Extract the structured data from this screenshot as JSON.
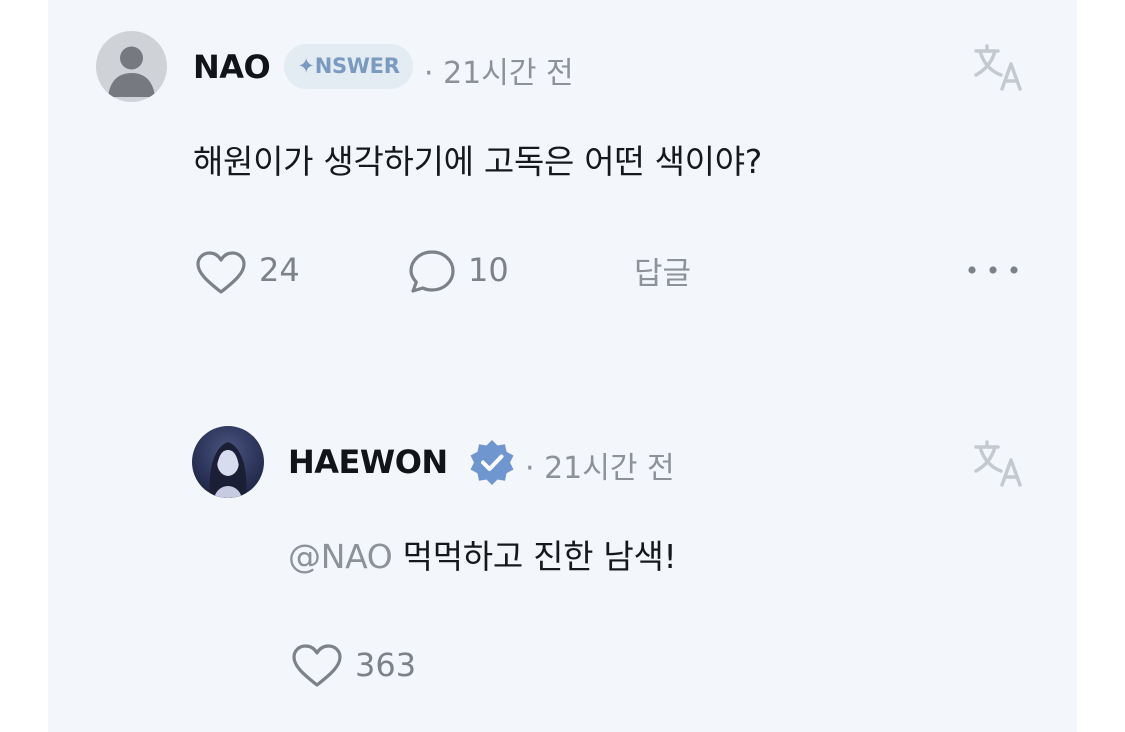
{
  "comment": {
    "username": "NAO",
    "badge": "✦NSWER",
    "time": "· 21시간 전",
    "text": "해원이가 생각하기에 고독은 어떤 색이야?",
    "likes": "24",
    "replies": "10",
    "reply_label": "답글",
    "more_icon": "more-horizontal-icon",
    "translate_icon": "translate-icon"
  },
  "reply": {
    "username": "HAEWON",
    "verified_icon": "verified-badge-icon",
    "time": "· 21시간 전",
    "mention": "@NAO",
    "text": " 먹먹하고 진한 남색!",
    "likes": "363",
    "translate_icon": "translate-icon"
  },
  "colors": {
    "card_bg": "#f3f6fa",
    "muted_text": "#8d9298",
    "badge_bg": "#e3ebf3",
    "badge_text": "#7b9ac0",
    "verified": "#6f96cf"
  }
}
